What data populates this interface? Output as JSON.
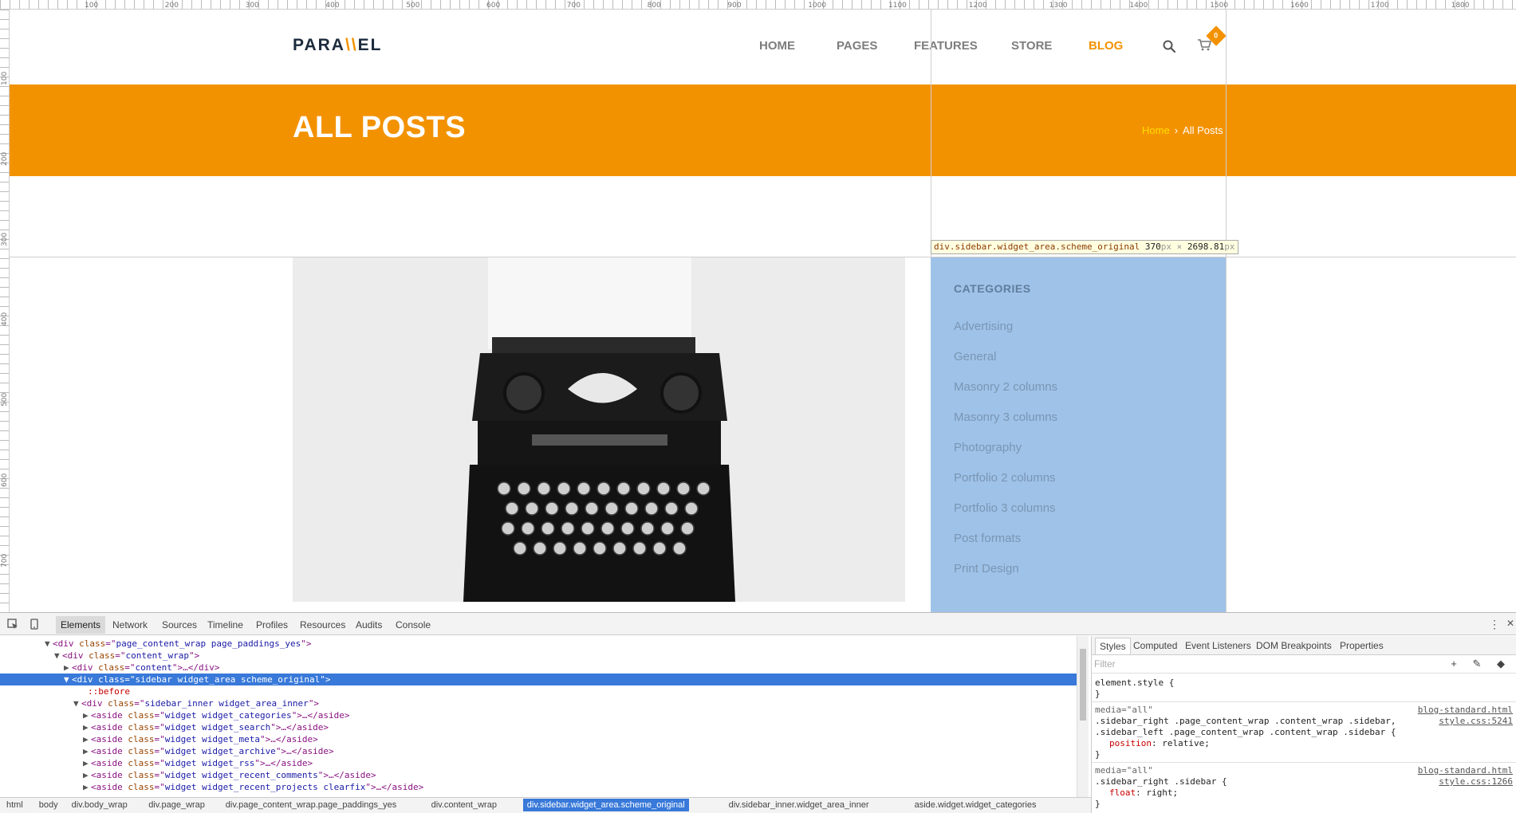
{
  "site": {
    "logo_left": "PARA",
    "logo_mark": "\\\\",
    "logo_right": "EL",
    "nav": [
      {
        "label": "HOME",
        "active": false
      },
      {
        "label": "PAGES",
        "active": false
      },
      {
        "label": "FEATURES",
        "active": false
      },
      {
        "label": "STORE",
        "active": false
      },
      {
        "label": "BLOG",
        "active": true
      }
    ],
    "cart_count": "0"
  },
  "title_band": {
    "title": "ALL POSTS",
    "breadcrumb_home": "Home",
    "breadcrumb_sep": "›",
    "breadcrumb_current": "All Posts"
  },
  "ruler": {
    "top_ticks": [
      "100",
      "200",
      "300",
      "400",
      "500",
      "600",
      "700",
      "800",
      "900",
      "1000",
      "1100",
      "1200",
      "1300",
      "1400",
      "1500",
      "1600",
      "1700",
      "1800"
    ],
    "left_ticks": [
      "100",
      "200",
      "300",
      "400",
      "500",
      "600",
      "700"
    ]
  },
  "inspector_tooltip": {
    "selector": "div.sidebar.widget_area.scheme_original",
    "width": "370",
    "height": "2698.81",
    "unit": "px",
    "times": "×"
  },
  "sidebar": {
    "title": "CATEGORIES",
    "categories": [
      "Advertising",
      "General",
      "Masonry 2 columns",
      "Masonry 3 columns",
      "Photography",
      "Portfolio 2 columns",
      "Portfolio 3 columns",
      "Post formats",
      "Print Design"
    ]
  },
  "devtools": {
    "tabs": [
      "Elements",
      "Network",
      "Sources",
      "Timeline",
      "Profiles",
      "Resources",
      "Audits",
      "Console"
    ],
    "active_tab": "Elements",
    "dom_lines": [
      {
        "tri": "▼",
        "tag": "div",
        "cls": "page_content_wrap page_paddings_yes",
        "tail": ">",
        "selected": false
      },
      {
        "tri": "▼",
        "tag": "div",
        "cls": "content_wrap",
        "tail": ">",
        "selected": false
      },
      {
        "tri": "▶",
        "tag": "div",
        "cls": "content",
        "tail": ">…</div>",
        "selected": false
      },
      {
        "tri": "▼",
        "tag": "div",
        "cls": "sidebar widget_area scheme_original",
        "tail": ">",
        "selected": true
      },
      {
        "tri": "",
        "pseudo": "::before",
        "selected": false
      },
      {
        "tri": "▼",
        "tag": "div",
        "cls": "sidebar_inner widget_area_inner",
        "tail": ">",
        "selected": false
      },
      {
        "tri": "▶",
        "tag": "aside",
        "cls": "widget widget_categories",
        "tail": ">…</aside>",
        "selected": false
      },
      {
        "tri": "▶",
        "tag": "aside",
        "cls": "widget widget_search",
        "tail": ">…</aside>",
        "selected": false
      },
      {
        "tri": "▶",
        "tag": "aside",
        "cls": "widget widget_meta",
        "tail": ">…</aside>",
        "selected": false
      },
      {
        "tri": "▶",
        "tag": "aside",
        "cls": "widget widget_archive",
        "tail": ">…</aside>",
        "selected": false
      },
      {
        "tri": "▶",
        "tag": "aside",
        "cls": "widget widget_rss",
        "tail": ">…</aside>",
        "selected": false
      },
      {
        "tri": "▶",
        "tag": "aside",
        "cls": "widget widget_recent_comments",
        "tail": ">…</aside>",
        "selected": false
      },
      {
        "tri": "▶",
        "tag": "aside",
        "cls": "widget widget_recent_projects clearfix",
        "tail": ">…</aside>",
        "selected": false
      }
    ],
    "styles_tabs": [
      "Styles",
      "Computed",
      "Event Listeners",
      "DOM Breakpoints",
      "Properties"
    ],
    "filter_placeholder": "Filter",
    "rules": {
      "element_style": "element.style {",
      "close": "}",
      "r1_media": "media=\"all\"",
      "r1_sel1": ".sidebar_right .page_content_wrap .content_wrap .sidebar,",
      "r1_sel2": ".sidebar_left .page_content_wrap .content_wrap .sidebar {",
      "r1_prop": "position",
      "r1_val": "relative;",
      "r1_link1": "blog-standard.html",
      "r1_link2": "style.css:5241",
      "r2_media": "media=\"all\"",
      "r2_sel": ".sidebar_right .sidebar {",
      "r2_prop": "float",
      "r2_val": "right;",
      "r2_link1": "blog-standard.html",
      "r2_link2": "style.css:1266"
    },
    "breadcrumbs": [
      "html",
      "body",
      "div.body_wrap",
      "div.page_wrap",
      "div.page_content_wrap.page_paddings_yes",
      "div.content_wrap",
      "div.sidebar.widget_area.scheme_original",
      "div.sidebar_inner.widget_area_inner",
      "aside.widget.widget_categories"
    ],
    "active_breadcrumb": "div.sidebar.widget_area.scheme_original"
  }
}
